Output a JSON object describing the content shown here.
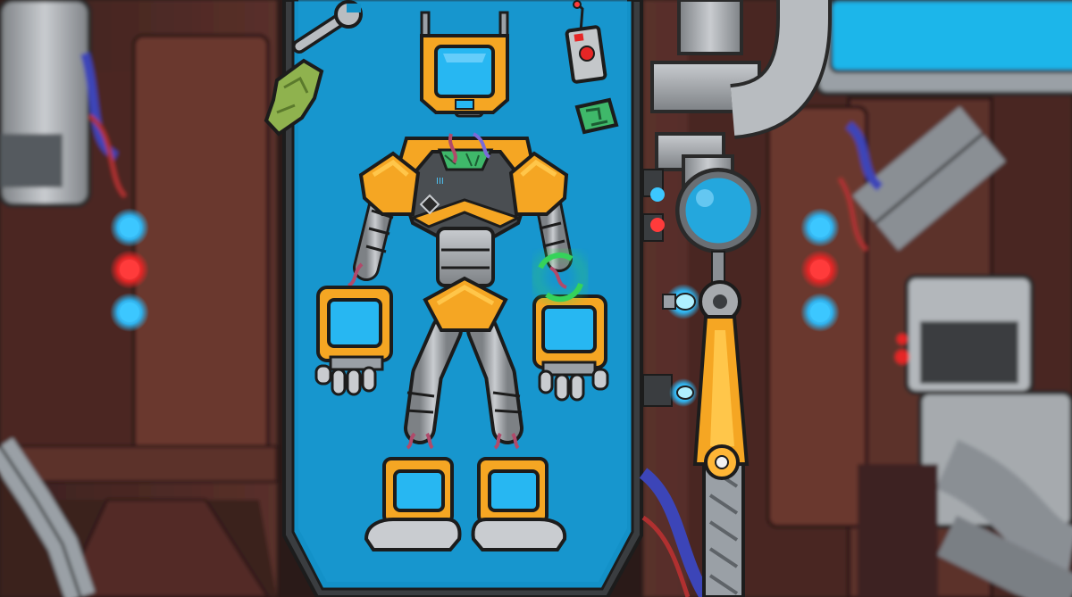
{
  "game": {
    "scene": "robot-assembly-lab",
    "panel_color": "#1391c8",
    "accent_orange": "#f5a623",
    "metal_gray": "#9aa0a6",
    "screen_blue": "#27b7f2",
    "circuit_green": "#3fb86a",
    "target_ring_color": "#35d35a",
    "monitor_color": "#1ab6ea",
    "wall_color": "#5a2d26",
    "indicator_lights": [
      "#3cc7ff",
      "#ff3b3b",
      "#3cc7ff"
    ],
    "robot_parts": [
      "head",
      "torso",
      "left-shoulder",
      "right-shoulder",
      "pelvis",
      "left-arm",
      "right-arm",
      "left-hand",
      "right-hand",
      "left-leg",
      "right-leg",
      "left-foot",
      "right-foot"
    ],
    "tools": [
      "wrench",
      "rag",
      "remote-detonator",
      "circuit-chip"
    ],
    "machinery": [
      "magnifier",
      "lever",
      "pipes",
      "monitor",
      "light-bulb"
    ]
  }
}
